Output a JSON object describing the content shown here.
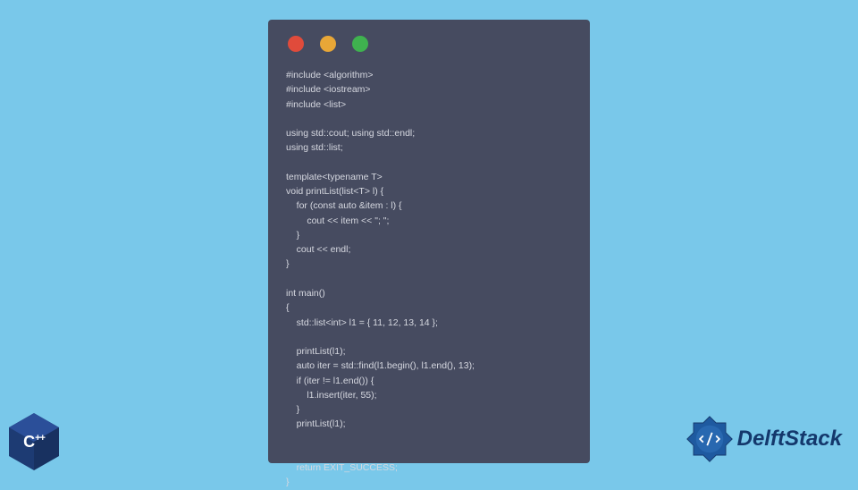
{
  "colors": {
    "background": "#79c8ea",
    "window": "#464b60",
    "text": "#d6d8e0",
    "red": "#e04b3b",
    "yellow": "#e8a737",
    "green": "#3fb24f",
    "cpp_badge": "#1d3b73",
    "delft_primary": "#14386c"
  },
  "window": {
    "code": "#include <algorithm>\n#include <iostream>\n#include <list>\n\nusing std::cout; using std::endl;\nusing std::list;\n\ntemplate<typename T>\nvoid printList(list<T> l) {\n    for (const auto &item : l) {\n        cout << item << \"; \";\n    }\n    cout << endl;\n}\n\nint main()\n{\n    std::list<int> l1 = { 11, 12, 13, 14 };\n\n    printList(l1);\n    auto iter = std::find(l1.begin(), l1.end(), 13);\n    if (iter != l1.end()) {\n        l1.insert(iter, 55);\n    }\n    printList(l1);\n\n\n    return EXIT_SUCCESS;\n}"
  },
  "badges": {
    "cpp_label": "C",
    "cpp_plus": "++",
    "delft_label": "DelftStack"
  },
  "icons": {
    "traffic_red": "traffic-light-red-icon",
    "traffic_yellow": "traffic-light-yellow-icon",
    "traffic_green": "traffic-light-green-icon",
    "cpp": "cpp-hexagon-icon",
    "delft": "delft-gear-icon"
  }
}
